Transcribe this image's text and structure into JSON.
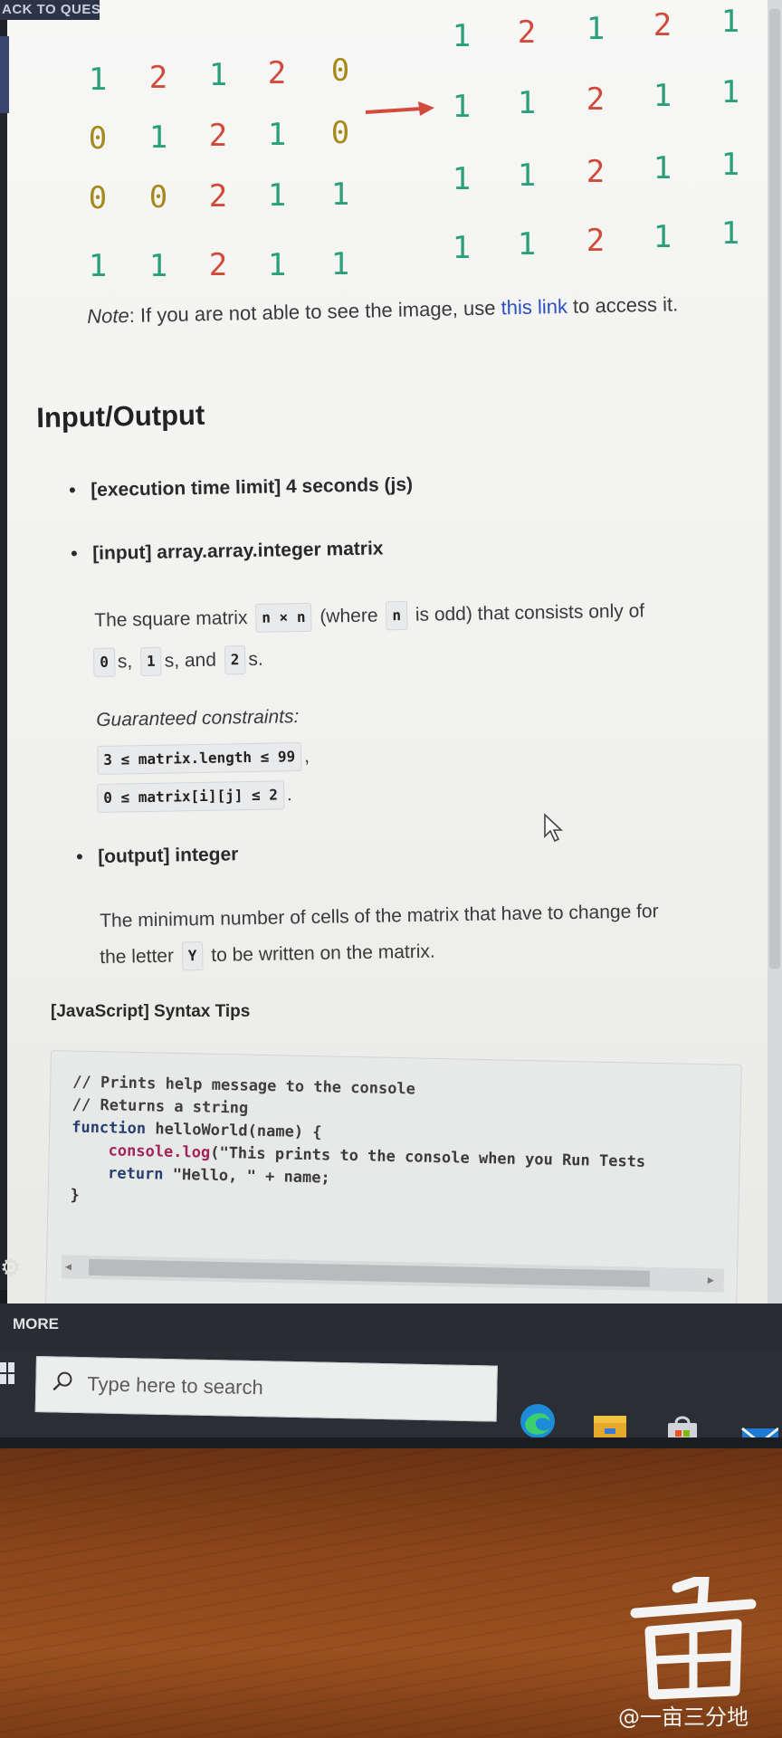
{
  "header": {
    "back_label": "ACK TO QUEST"
  },
  "matrix_left": [
    [
      "1",
      "2",
      "1",
      "2",
      "0"
    ],
    [
      "0",
      "1",
      "2",
      "1",
      "0"
    ],
    [
      "0",
      "0",
      "2",
      "1",
      "1"
    ],
    [
      "1",
      "1",
      "2",
      "1",
      "1"
    ]
  ],
  "matrix_right": [
    [
      "1",
      "2",
      "1",
      "2",
      "1"
    ],
    [
      "1",
      "1",
      "2",
      "1",
      "1"
    ],
    [
      "1",
      "1",
      "2",
      "1",
      "1"
    ],
    [
      "1",
      "1",
      "2",
      "1",
      "1"
    ]
  ],
  "note": {
    "label": "Note",
    "text_before": ": If you are not able to see the image, use ",
    "link": "this link",
    "text_after": " to access it."
  },
  "section_title": "Input/Output",
  "bullets": {
    "time_limit": "[execution time limit] 4 seconds (js)",
    "input": "[input] array.array.integer matrix",
    "output": "[output] integer"
  },
  "input_desc": {
    "p1_a": "The square matrix",
    "chip_nxn": "n × n",
    "p1_b": "(where",
    "chip_n": "n",
    "p1_c": "is odd) that consists only of",
    "chip_0": "0",
    "p2_a": "s,",
    "chip_1": "1",
    "p2_b": "s, and",
    "chip_2": "2",
    "p2_c": "s.",
    "constraints_label": "Guaranteed constraints:",
    "constraint_1": "3 ≤ matrix.length ≤ 99",
    "constraint_1_suffix": ",",
    "constraint_2": "0 ≤ matrix[i][j] ≤ 2",
    "constraint_2_suffix": "."
  },
  "output_desc": {
    "line1": "The minimum number of cells of the matrix that have to change for",
    "line2_a": "the letter",
    "chip_y": "Y",
    "line2_b": "to be written on the matrix."
  },
  "tips_title": "[JavaScript] Syntax Tips",
  "code": {
    "line1": "// Prints help message to the console",
    "line2": "// Returns a string",
    "line3_kw": "function",
    "line3_rest": " helloWorld(name) {",
    "line4_obj": "console.log",
    "line4_rest": "(\"This prints to the console when you Run Tests",
    "line5_kw": "return",
    "line5_rest": " \"Hello, \" + name;",
    "line6": "}"
  },
  "more_label": "MORE",
  "taskbar": {
    "search_placeholder": "Type here to search"
  },
  "watermark_text": "@一亩三分地",
  "colors": {
    "digit_0": "#a58a1c",
    "digit_1": "#2aa078",
    "digit_2": "#d14b3d",
    "link": "#2b4fc0"
  }
}
